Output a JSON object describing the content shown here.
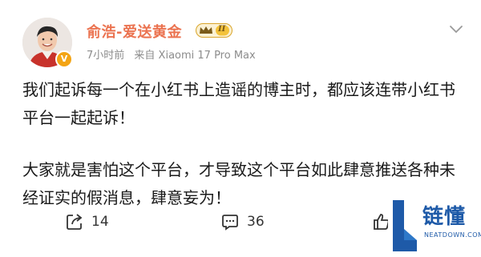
{
  "post": {
    "author": {
      "name": "俞浩-爱送黄金",
      "verified_badge": "V",
      "level_badge": "II"
    },
    "time": "7小时前",
    "source": "来自 Xiaomi 17 Pro Max",
    "paragraphs": [
      "我们起诉每一个在小红书上造谣的博主时，都应该连带小红书平台一起起诉！",
      "大家就是害怕这个平台，才导致这个平台如此肆意推送各种未经证实的假消息，肆意妄为！"
    ],
    "actions": {
      "repost_count": "14",
      "comment_count": "36"
    }
  },
  "watermark": {
    "text": "链懂",
    "sub": "NEATDOWN.COM"
  },
  "colors": {
    "username": "#eb7350",
    "meta": "#8c8c8c",
    "badge": "#f3a414",
    "watermark": "#1e5aa8"
  },
  "icons": {
    "menu": "chevron-down-icon",
    "repost": "share-icon",
    "comment": "comment-icon",
    "like": "thumbs-up-icon",
    "badge": "crown-level-icon",
    "logo": "watermark-logo-icon"
  }
}
